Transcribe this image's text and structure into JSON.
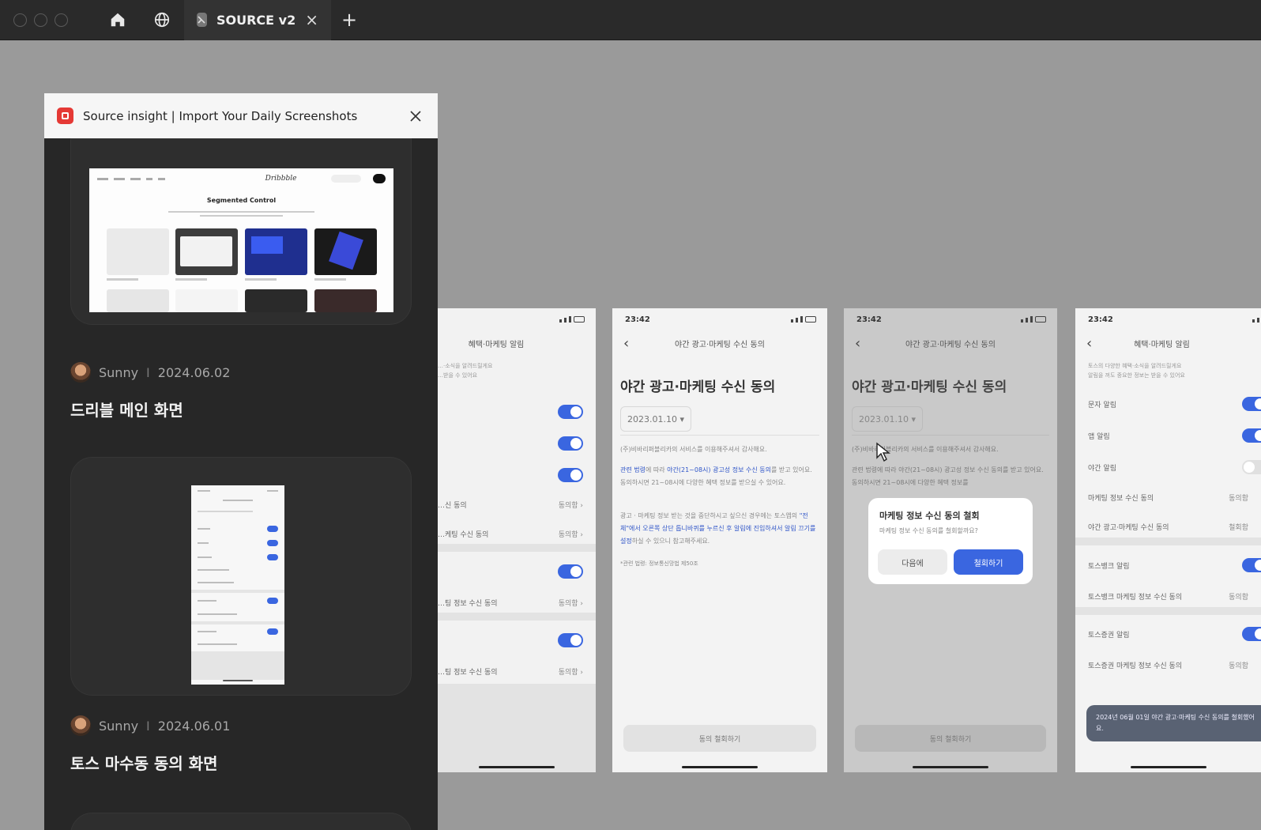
{
  "browser": {
    "tab_label": "SOURCE v2",
    "tab_close": "×",
    "new_tab": "+"
  },
  "panel": {
    "title": "Source insight | Import Your Daily Screenshots",
    "posts": [
      {
        "author": "Sunny",
        "separator": "I",
        "date": "2024.06.02",
        "title": "드리블 메인 화면"
      },
      {
        "author": "Sunny",
        "separator": "I",
        "date": "2024.06.01",
        "title": "토스 마수동 동의 화면"
      }
    ],
    "dribbble_thumb": {
      "logo": "Dribbble",
      "heading": "Segmented Control"
    }
  },
  "phones": {
    "p0": {
      "nav_title": "혜택·마케팅 알림",
      "desc": "…·소식을 알려드릴게요\n…받을 수 있어요",
      "rows": [
        {
          "label": "…신 동의",
          "value": "동의함 ›"
        },
        {
          "label": "…케팅 수신 동의",
          "value": "동의함 ›"
        },
        {
          "label": "…팅 정보 수신 동의",
          "value": "동의함 ›"
        },
        {
          "label": "…팅 정보 수신 동의",
          "value": "동의함 ›"
        }
      ]
    },
    "p1": {
      "time": "23:42",
      "nav_back": "‹",
      "nav_title": "야간 광고·마케팅 수신 동의",
      "heading": "야간 광고·마케팅 수신 동의",
      "date": "2023.01.10 ▾",
      "para1": "(주)비바리퍼블리카의 서비스를 이용해주셔서 감사해요.",
      "para2a": "관련 법령",
      "para2b": "에 따라 ",
      "para2c": "야간(21~08시) 광고성 정보 수신 동의",
      "para2d": "를 받고 있어요. 동의하시면 21~08시에 다양한 혜택 정보를 받으실 수 있어요.",
      "para3a": "광고 · 마케팅 정보 받는 것을 중단하시고 싶으신 경우에는 토스앱의 ",
      "para3b": "\"전체\"에서 오른쪽 상단 톱니바퀴를 누르신 후 알림에 진입하셔서 알림 끄기를 설정",
      "para3c": "하실 수 있으니 참고해주세요.",
      "footnote": "*관련 법령: 정보통신망법 제50조",
      "button": "동의 철회하기"
    },
    "p2": {
      "time": "23:42",
      "nav_back": "‹",
      "nav_title": "야간 광고·마케팅 수신 동의",
      "heading": "야간 광고·마케팅 수신 동의",
      "date": "2023.01.10 ▾",
      "para1": "(주)비바리퍼블리카의 서비스를 이용해주셔서 감사해요.",
      "para2": "관련 법령에 따라 야간(21~08시) 광고성 정보 수신 동의를 받고 있어요. 동의하시면 21~08시에 다양한 혜택 정보를",
      "button": "동의 철회하기",
      "dialog": {
        "title": "마케팅 정보 수신 동의 철회",
        "subtitle": "마케팅 정보 수신 동의를 철회할까요?",
        "cancel": "다음에",
        "confirm": "철회하기"
      }
    },
    "p3": {
      "time": "23:42",
      "nav_back": "‹",
      "nav_title": "혜택·마케팅 알림",
      "desc": "토스의 다양한 혜택·소식을 알려드릴게요\n알림을 꺼도 중요한 정보는 받을 수 있어요",
      "rows": [
        {
          "label": "문자 알림"
        },
        {
          "label": "앱 알림"
        },
        {
          "label": "야간 알림"
        },
        {
          "label": "마케팅 정보 수신 동의",
          "value": "동의함"
        },
        {
          "label": "야간 광고·마케팅 수신 동의",
          "value": "철회함"
        },
        {
          "label": "토스뱅크 알림"
        },
        {
          "label": "토스뱅크 마케팅 정보 수신 동의",
          "value": "동의함"
        },
        {
          "label": "토스증권 알림"
        },
        {
          "label": "토스증권 마케팅 정보 수신 동의",
          "value": "동의함"
        }
      ],
      "toast": "2024년 06월 01일 야간 광고·마케팅 수신 동의를 철회했어요."
    }
  }
}
